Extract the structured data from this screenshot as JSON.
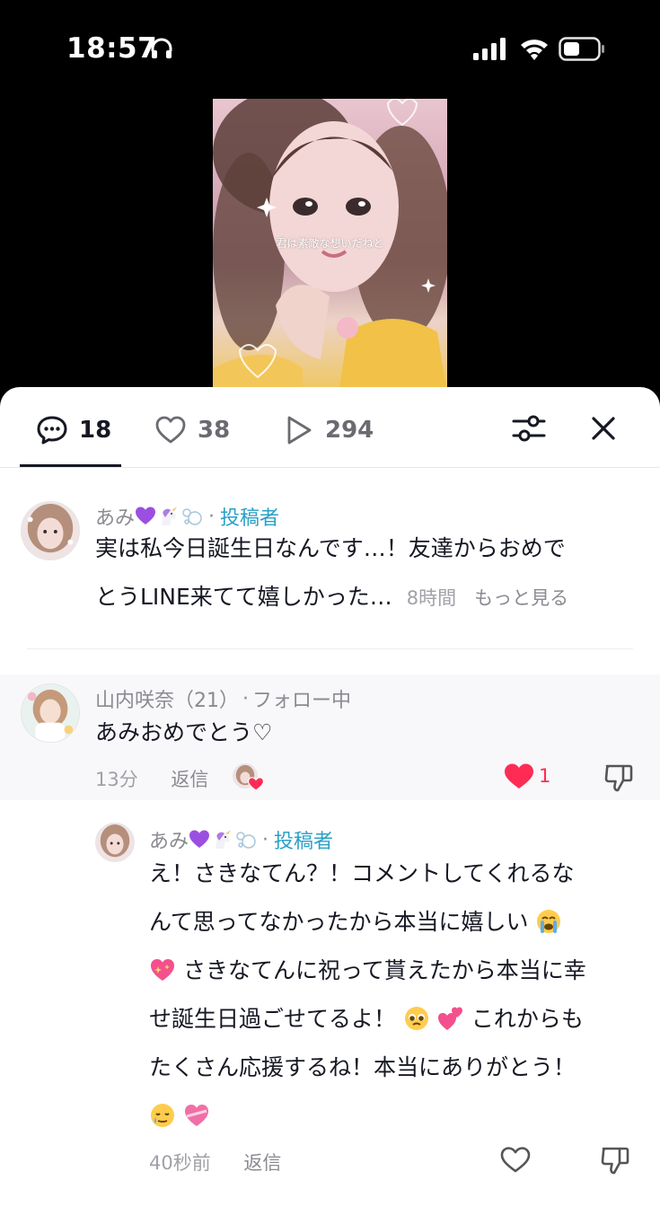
{
  "status_bar": {
    "time": "18:57"
  },
  "video": {
    "caption": "君は素敵な想いだねと"
  },
  "tabs": {
    "comments_count": "18",
    "likes_count": "38",
    "views_count": "294"
  },
  "comments": [
    {
      "name": "あみ",
      "separator": "·",
      "author_tag": "投稿者",
      "line1": "実は私今日誕生日なんです…！友達からおめで",
      "line2": "とうLINE来てて嬉しかった…",
      "time": "8時間",
      "more": "もっと見る"
    },
    {
      "name": "山内咲奈（21）",
      "separator": "·",
      "follow_tag": "フォロー中",
      "text": "あみおめでとう♡",
      "time": "13分",
      "reply": "返信",
      "likes": "1"
    },
    {
      "name": "あみ",
      "separator": "·",
      "author_tag": "投稿者",
      "line1": "え！さきなてん？！コメントしてくれるな",
      "line2": "んて思ってなかったから本当に嬉しい",
      "line3": "さきなてんに祝って貰えたから本当に幸",
      "line4a": "せ誕生日過ごせてるよ！",
      "line4b": "これからも",
      "line5": "たくさん応援するね！本当にありがとう！",
      "time": "40秒前",
      "reply": "返信"
    }
  ]
}
